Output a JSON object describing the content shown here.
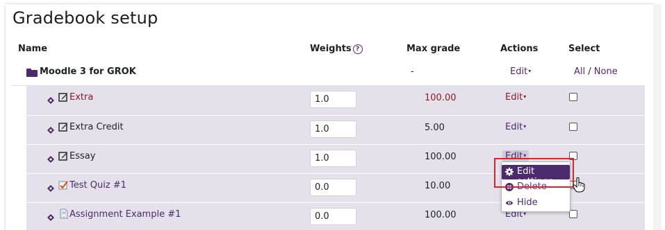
{
  "page": {
    "title": "Gradebook setup"
  },
  "headers": {
    "name": "Name",
    "weights": "Weights",
    "weights_help": "?",
    "max_grade": "Max grade",
    "actions": "Actions",
    "select": "Select"
  },
  "category": {
    "name": "Moodle 3 for GROK",
    "max_grade": "-",
    "edit": "Edit",
    "caret": "▾",
    "select_all": "All",
    "select_sep": "/",
    "select_none": "None"
  },
  "items": [
    {
      "name": "Extra",
      "weight": "1.0",
      "max_grade": "100.00",
      "edit": "Edit",
      "icon": "edit-icon"
    },
    {
      "name": "Extra Credit",
      "weight": "1.0",
      "max_grade": "5.00",
      "edit": "Edit",
      "icon": "edit-icon"
    },
    {
      "name": "Essay",
      "weight": "1.0",
      "max_grade": "100.00",
      "edit": "Edit",
      "icon": "edit-icon"
    },
    {
      "name": "Test Quiz #1",
      "weight": "0.0",
      "max_grade": "10.00",
      "edit": "Edit",
      "icon": "quiz-icon"
    },
    {
      "name": "Assignment Example #1",
      "weight": "0.0",
      "max_grade": "100.00",
      "edit": "Edit",
      "icon": "assignment-icon"
    }
  ],
  "dropdown": {
    "edit_settings": "Edit settings",
    "delete": "Delete",
    "hide": "Hide"
  },
  "colors": {
    "accent": "#4b2a6e",
    "row_bg": "#e4e1ea",
    "highlight": "#e4212b",
    "overridden_text": "#8b1a2b"
  }
}
